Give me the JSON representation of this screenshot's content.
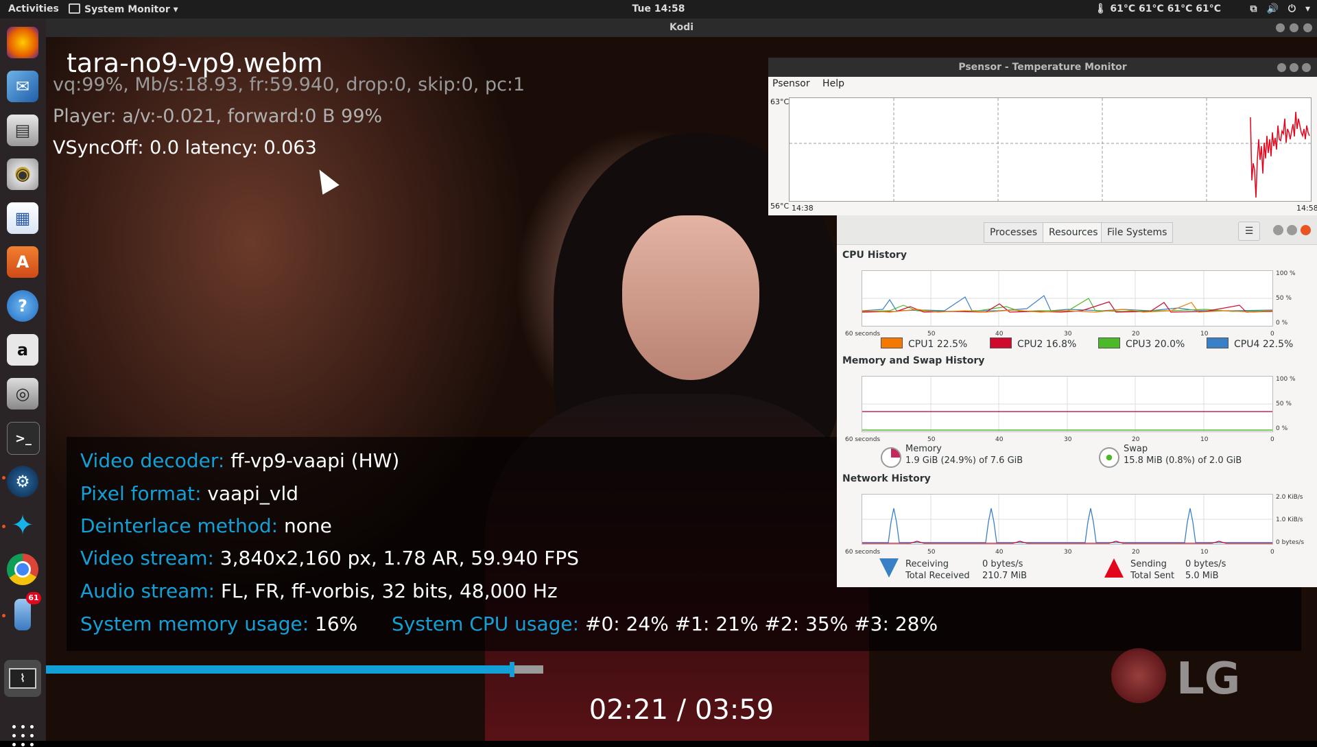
{
  "topbar": {
    "activities": "Activities",
    "app_menu": "System Monitor",
    "clock": "Tue 14:58",
    "temperatures": "61°C 61°C 61°C 61°C"
  },
  "dock": {
    "icons": [
      "firefox-icon",
      "thunderbird-icon",
      "files-icon",
      "rhythmbox-icon",
      "libreoffice-writer-icon",
      "software-center-icon",
      "help-icon",
      "amazon-icon",
      "camera-icon",
      "terminal-icon",
      "steam-icon",
      "kodi-icon",
      "chrome-icon",
      "device-icon",
      "system-monitor-icon"
    ],
    "badge_count": "61"
  },
  "kodi": {
    "window_title": "Kodi",
    "filename": "tara-no9-vp9.webm",
    "line1": "vq:99%, Mb/s:18.93, fr:59.940, drop:0, skip:0, pc:1",
    "line2": "Player: a/v:-0.021,  forward:0 B 99%",
    "line3": "VSyncOff: 0.0 latency: 0.063",
    "info": {
      "video_decoder": {
        "label": "Video decoder:",
        "value": " ff-vp9-vaapi (HW)"
      },
      "pixel_format": {
        "label": "Pixel format:",
        "value": " vaapi_vld"
      },
      "deinterlace": {
        "label": "Deinterlace method:",
        "value": " none"
      },
      "video_stream": {
        "label": "Video stream:",
        "value": " 3,840x2,160 px, 1.78 AR, 59.940 FPS"
      },
      "audio_stream": {
        "label": "Audio stream:",
        "value": " FL, FR, ff-vorbis, 32 bits, 48,000 Hz"
      },
      "memory_usage": {
        "label": "System memory usage:",
        "value": " 16%"
      },
      "cpu_usage": {
        "label": "System CPU usage:",
        "value": " #0:  24% #1:  21% #2:  35% #3:  28%"
      }
    },
    "progress_fraction": 0.59,
    "buffered_fraction": 0.63,
    "time": "02:21 / 03:59",
    "logo": "LG"
  },
  "psensor": {
    "window_title": "Psensor - Temperature Monitor",
    "menu": [
      "Psensor",
      "Help"
    ],
    "y_max": "63°C",
    "y_min": "56°C",
    "x_start": "14:38",
    "x_end": "14:58"
  },
  "sysmon": {
    "tabs": [
      "Processes",
      "Resources",
      "File Systems"
    ],
    "cpu_title": "CPU History",
    "memory_title": "Memory and Swap History",
    "network_title": "Network History",
    "x_ticks": [
      "60 seconds",
      "50",
      "40",
      "30",
      "20",
      "10",
      "0"
    ],
    "pct_ticks": [
      "100 %",
      "50 %",
      "0 %"
    ],
    "net_ticks": [
      "2.0 KiB/s",
      "1.0 KiB/s",
      "0 bytes/s"
    ],
    "cpus": [
      {
        "name": "CPU1",
        "value": "22.5%",
        "color": "#f57900"
      },
      {
        "name": "CPU2",
        "value": "16.8%",
        "color": "#d00a2c"
      },
      {
        "name": "CPU3",
        "value": "20.0%",
        "color": "#4cb92a"
      },
      {
        "name": "CPU4",
        "value": "22.5%",
        "color": "#3a80c6"
      }
    ],
    "memory": {
      "label": "Memory",
      "detail": "1.9 GiB (24.9%) of 7.6 GiB"
    },
    "swap": {
      "label": "Swap",
      "detail": "15.8 MiB (0.8%) of 2.0 GiB"
    },
    "network": {
      "receiving_label": "Receiving",
      "receiving_value": "0 bytes/s",
      "total_received_label": "Total Received",
      "total_received_value": "210.7 MiB",
      "sending_label": "Sending",
      "sending_value": "0 bytes/s",
      "total_sent_label": "Total Sent",
      "total_sent_value": "5.0 MiB"
    }
  }
}
